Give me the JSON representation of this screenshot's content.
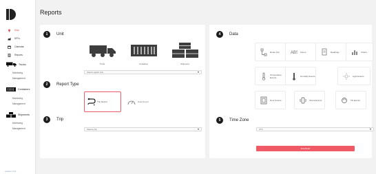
{
  "app": {
    "version": "version 1.0.0"
  },
  "page": {
    "title": "Reports"
  },
  "sidebar": {
    "items": [
      {
        "label": "Map",
        "icon": "map-pin-icon",
        "active": true
      },
      {
        "label": "KPI's",
        "icon": "chart-icon"
      },
      {
        "label": "Calendar",
        "icon": "calendar-icon"
      },
      {
        "label": "Reports",
        "icon": "report-icon"
      }
    ],
    "groups": [
      {
        "label": "Trucks",
        "icon": "truck-icon",
        "subs": [
          "Monitoring",
          "Management"
        ]
      },
      {
        "label": "Containers",
        "icon": "container-icon",
        "subs": [
          "Monitoring",
          "Management"
        ]
      },
      {
        "label": "Shipments",
        "icon": "shipment-icon",
        "subs": [
          "Monitoring",
          "Management"
        ]
      }
    ]
  },
  "steps": {
    "unit": {
      "number": "1",
      "label": "Unit"
    },
    "report_type": {
      "number": "2",
      "label": "Report Type"
    },
    "trip": {
      "number": "3",
      "label": "Trip"
    },
    "data": {
      "number": "4",
      "label": "Data"
    },
    "time_zone": {
      "number": "5",
      "label": "Time Zone"
    }
  },
  "unit_options": [
    {
      "label": "Truck",
      "icon": "truck-icon"
    },
    {
      "label": "Container",
      "icon": "container-icon"
    },
    {
      "label": "Shipment",
      "icon": "boxes-icon"
    }
  ],
  "unit_select": {
    "placeholder": "Select Logistic Unit"
  },
  "report_types": [
    {
      "label": "Trip Report",
      "icon": "trip-route-icon",
      "selected": true
    },
    {
      "label": "Data Report",
      "icon": "gauge-icon",
      "selected": false
    }
  ],
  "trip_select": {
    "placeholder": "Select a trip"
  },
  "data_options": [
    {
      "label": "Route Info",
      "icon": "route-icon"
    },
    {
      "label": "Zones",
      "icon": "zones-icon"
    },
    {
      "label": "Readings",
      "icon": "document-icon"
    },
    {
      "label": "Charts",
      "icon": "bar-chart-icon"
    },
    {
      "label": "Temperature Events",
      "icon": "thermometer-icon"
    },
    {
      "label": "Humidity Events",
      "icon": "humidity-icon"
    },
    {
      "label": "Light Events",
      "icon": "light-icon"
    },
    {
      "label": "Door Events",
      "icon": "door-icon"
    },
    {
      "label": "Shock Events",
      "icon": "shock-icon"
    },
    {
      "label": "Tilt Events",
      "icon": "tilt-icon"
    }
  ],
  "time_zone_select": {
    "value": "UTC"
  },
  "submit": {
    "label": "Download"
  },
  "colors": {
    "accent": "#ef5a66",
    "active_nav": "#e05a66",
    "sidebar_bg": "#ffffff",
    "page_bg": "#f2f2f3"
  }
}
